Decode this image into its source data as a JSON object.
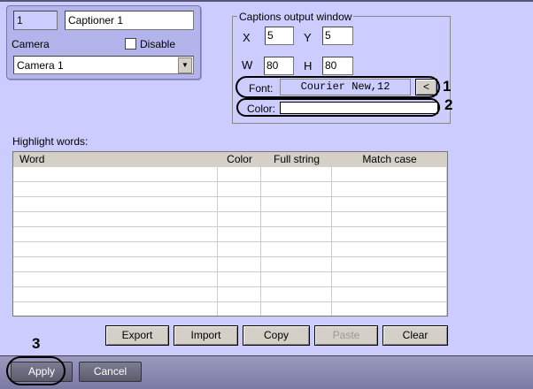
{
  "object": {
    "id": "1",
    "name": "Captioner 1",
    "camera_label": "Camera",
    "disable_label": "Disable",
    "disable_checked": false,
    "camera_value": "Camera 1"
  },
  "captions": {
    "title": "Captions output window",
    "x_label": "X",
    "x": "5",
    "y_label": "Y",
    "y": "5",
    "w_label": "W",
    "w": "80",
    "h_label": "H",
    "h": "80",
    "font_label": "Font:",
    "font_value": "Courier New,12",
    "font_button": "<",
    "color_label": "Color:",
    "color_value": "#ffffff"
  },
  "annotations": [
    "1",
    "2",
    "3"
  ],
  "highlight": {
    "label": "Highlight words:",
    "columns": [
      "Word",
      "Color",
      "Full string",
      "Match case"
    ],
    "row_count": 10
  },
  "buttons": {
    "export": "Export",
    "import": "Import",
    "copy": "Copy",
    "paste": "Paste",
    "clear": "Clear"
  },
  "footer": {
    "apply": "Apply",
    "cancel": "Cancel"
  }
}
